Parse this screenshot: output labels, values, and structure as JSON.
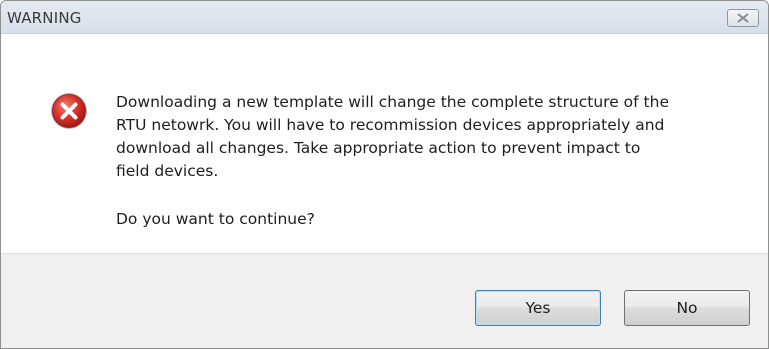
{
  "window": {
    "title": "WARNING",
    "close_icon": "close-icon"
  },
  "message": {
    "icon": "error-icon",
    "icon_color": "#d9342b",
    "body_lines": [
      "Downloading a new template will change the complete structure of the",
      "RTU netowrk. You will have to recommission devices appropriately and",
      "download all changes. Take appropriate action to prevent impact to",
      "field devices."
    ],
    "question": "Do you want to continue?"
  },
  "buttons": {
    "yes_label": "Yes",
    "no_label": "No",
    "default": "Yes"
  }
}
